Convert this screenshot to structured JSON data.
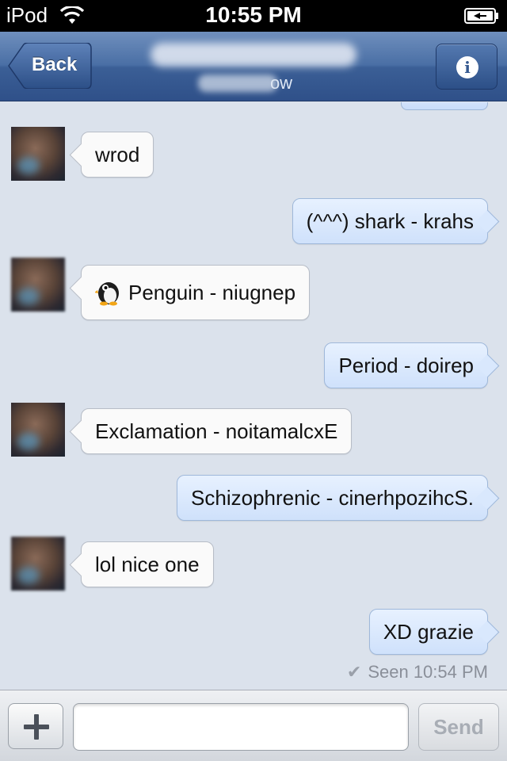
{
  "status_bar": {
    "carrier": "iPod",
    "time": "10:55 PM"
  },
  "nav": {
    "back_label": "Back",
    "subtitle": "ow",
    "info_icon": "i"
  },
  "messages": [
    {
      "direction": "in",
      "text": "wrod"
    },
    {
      "direction": "out",
      "text": "(^^^) shark - krahs"
    },
    {
      "direction": "in",
      "text": "Penguin - niugnep",
      "emoji": "penguin-icon"
    },
    {
      "direction": "out",
      "text": "Period - doirep"
    },
    {
      "direction": "in",
      "text": "Exclamation - noitamalcxE"
    },
    {
      "direction": "out",
      "text": "Schizophrenic - cinerhpozihcS."
    },
    {
      "direction": "in",
      "text": "lol nice one"
    },
    {
      "direction": "out",
      "text": "XD grazie"
    }
  ],
  "seen": {
    "text": "Seen 10:54 PM",
    "check": "✔"
  },
  "composer": {
    "input_value": "",
    "input_placeholder": "",
    "send_label": "Send"
  },
  "colors": {
    "nav_bar": "#4a6fa5",
    "outgoing_bubble": "#d6e6fc",
    "incoming_bubble": "#fafafa",
    "chat_background": "#dbe2ec"
  }
}
